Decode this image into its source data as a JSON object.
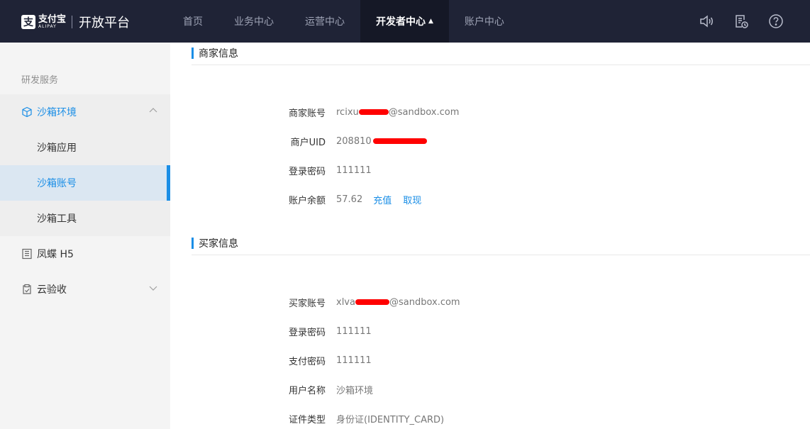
{
  "header": {
    "logo_cn": "支付宝",
    "logo_en": "ALIPAY",
    "platform_title": "开放平台",
    "nav": [
      {
        "label": "首页"
      },
      {
        "label": "业务中心"
      },
      {
        "label": "运营中心"
      },
      {
        "label": "开发者中心",
        "active": true
      },
      {
        "label": "账户中心"
      }
    ],
    "icons": [
      "speaker-icon",
      "document-clock-icon",
      "help-icon"
    ]
  },
  "sidebar": {
    "section_label": "研发服务",
    "sandbox": {
      "label": "沙箱环境",
      "expanded": true,
      "children": [
        {
          "label": "沙箱应用"
        },
        {
          "label": "沙箱账号",
          "selected": true
        },
        {
          "label": "沙箱工具"
        }
      ]
    },
    "fengdie": {
      "label": "凤蝶 H5"
    },
    "cloud_check": {
      "label": "云验收"
    }
  },
  "merchant": {
    "title": "商家信息",
    "account_label": "商家账号",
    "account_prefix": "rcixu",
    "account_suffix": "@sandbox.com",
    "uid_label": "商户UID",
    "uid_prefix": "208810",
    "password_label": "登录密码",
    "password_value": "111111",
    "balance_label": "账户余额",
    "balance_value": "57.62",
    "recharge_link": "充值",
    "withdraw_link": "取现"
  },
  "buyer": {
    "title": "买家信息",
    "account_label": "买家账号",
    "account_prefix": "xlva",
    "account_suffix": "@sandbox.com",
    "login_password_label": "登录密码",
    "login_password_value": "111111",
    "pay_password_label": "支付密码",
    "pay_password_value": "111111",
    "username_label": "用户名称",
    "username_value": "沙箱环境",
    "id_type_label": "证件类型",
    "id_type_value": "身份证(IDENTITY_CARD)"
  },
  "colors": {
    "topbar_bg": "#1f2336",
    "accent": "#1a8ee6",
    "redaction": "#ff0000"
  }
}
